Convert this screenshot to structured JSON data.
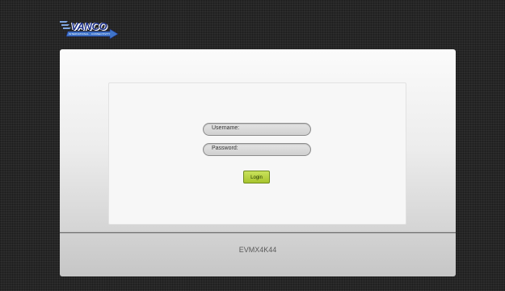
{
  "logo": {
    "text": "VANCO",
    "tagline": "INTERNATIONAL · CONNECTIVITY",
    "arrow_color": "#3f74c9",
    "text_color": "#1c2f86"
  },
  "login": {
    "username_label": "Username:",
    "password_label": "Password:",
    "button_label": "Login",
    "button_color": "#b5d23c"
  },
  "footer": {
    "model": "EVMX4K44"
  }
}
